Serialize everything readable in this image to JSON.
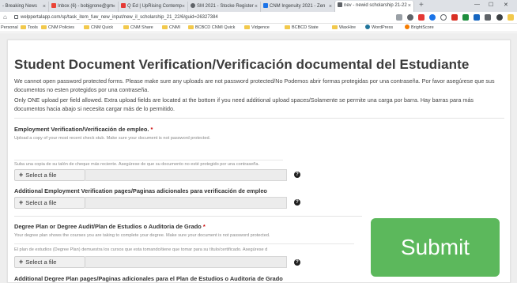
{
  "browser": {
    "tabs": [
      {
        "label": "- Breaking News",
        "color": "#c0392b"
      },
      {
        "label": "Inbox (6) - bobjgrone@gm",
        "color": "#ea4335"
      },
      {
        "label": "Q Ed | UpRising Contemp",
        "color": "#e53935"
      },
      {
        "label": "SM 2021 - Stocke Register",
        "color": "#5f6368"
      },
      {
        "label": "CNM Ingenuity 2021 - Zen",
        "color": "#1a73e8"
      },
      {
        "label": "nev - newid scholarship 21-22",
        "color": "#5f6368"
      }
    ],
    "new_tab_symbol": "+",
    "url": "welppertalapp.com/sp/task_item_fuw_new_input/new_il_scholarship_21_22/6/guid=26327384",
    "bookmarks": [
      "Personal",
      "Tools",
      "CNM Policies",
      "CNM Quick",
      "CNM Share",
      "CNMI",
      "BCBCD CNMI Quick",
      "Vidgence",
      "BCBCD State",
      "WaxHire",
      "WordPress",
      "BrightScore"
    ]
  },
  "page": {
    "title": "Student Document Verification/Verificación documental del Estudiante",
    "intro_1": "We cannot open password protected forms. Please make sure any uploads are not password protected/No Podemos abrir formas protegidas por una contraseña. Por favor asegúrese que sus documentos no esten protegidos por una contraseña.",
    "intro_2": "Only ONE upload per field allowed. Extra upload fields are located at the bottom if you need additional upload spaces/Solamente se permite una carga por barra. Hay barras para más documentos hacia abajo si necesita cargar más de lo permitido.",
    "sections": [
      {
        "label": "Employment Verification/Verificación de empleo.",
        "required": "*",
        "help_en": "Upload a copy of your most recent check stub. Make sure your document is not password protected.",
        "help_es": "Suba una copia de su talón de cheque más reciente. Asegúrese de que su documento no esté protegido por una contraseña."
      },
      {
        "label": "Additional Employment Verification pages/Paginas adicionales para verificación de empleo"
      },
      {
        "label": "Degree Plan or Degree Audit/Plan de Estudios o Auditoria de Grado",
        "required": "*",
        "help_en": "Your degree plan shows the courses you are taking to complete your degree. Make sure your document is not password protected.",
        "help_es": "El plan de estudios (Degree Plan) demuestra los cursos que esta tomando/tiene que tomar para su título/certificado. Asegúrese d"
      },
      {
        "label": "Additional Degree Plan pages/Paginas adicionales para el Plan de Estudios o Auditoria de Grado"
      }
    ],
    "select_file_label": "Select a file",
    "plus_symbol": "+",
    "help_symbol": "?",
    "submit_label": "Submit",
    "submit_color": "#5cb85c"
  }
}
